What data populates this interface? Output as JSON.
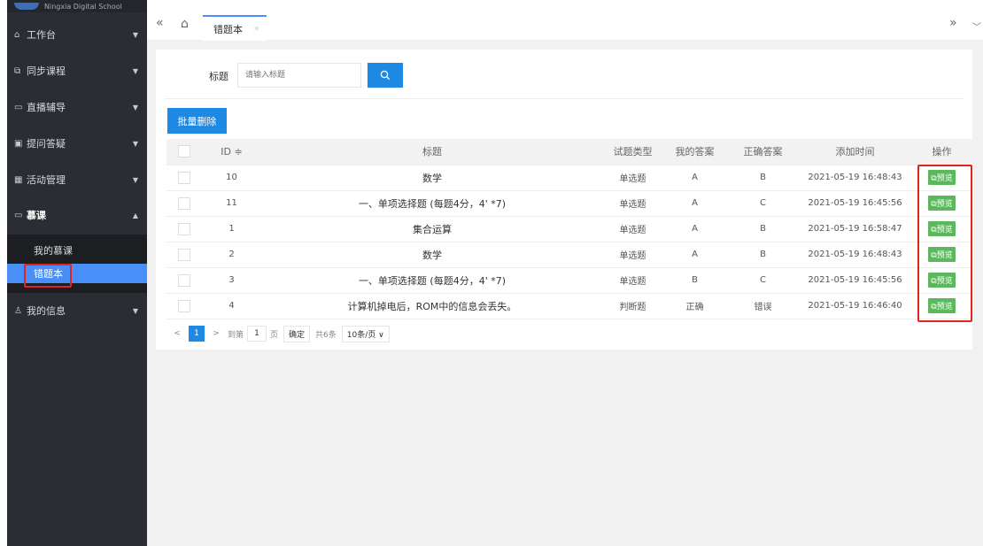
{
  "brand": {
    "name": "Ningxia Digital School"
  },
  "sidebar": {
    "items": [
      {
        "icon": "home-icon",
        "label": "工作台"
      },
      {
        "icon": "book-icon",
        "label": "同步课程"
      },
      {
        "icon": "broadcast-icon",
        "label": "直播辅导"
      },
      {
        "icon": "question-icon",
        "label": "提问答疑"
      },
      {
        "icon": "grid-icon",
        "label": "活动管理"
      },
      {
        "icon": "video-icon",
        "label": "慕课"
      },
      {
        "icon": "user-icon",
        "label": "我的信息"
      }
    ],
    "mooc_sub": [
      {
        "label": "我的慕课"
      },
      {
        "label": "错题本"
      }
    ]
  },
  "tabbar": {
    "collapse_icon": "«",
    "home_icon": "⌂",
    "active_tab": "错题本",
    "close_icon": "×",
    "next_icon": "»",
    "dropdown_icon": "﹀"
  },
  "search": {
    "label": "标题",
    "placeholder": "请输入标题"
  },
  "toolbar": {
    "batch_delete": "批量删除"
  },
  "table": {
    "headers": [
      "ID ≑",
      "标题",
      "试题类型",
      "我的答案",
      "正确答案",
      "添加时间",
      "操作"
    ],
    "rows": [
      {
        "id": "10",
        "title": "数学",
        "type": "单选题",
        "mine": "A",
        "correct": "B",
        "time": "2021-05-19 16:48:43",
        "action": "预览"
      },
      {
        "id": "11",
        "title": "一、单项选择题 (每题4分，4' *7)",
        "type": "单选题",
        "mine": "A",
        "correct": "C",
        "time": "2021-05-19 16:45:56",
        "action": "预览"
      },
      {
        "id": "1",
        "title": "集合运算",
        "type": "单选题",
        "mine": "A",
        "correct": "B",
        "time": "2021-05-19 16:58:47",
        "action": "预览"
      },
      {
        "id": "2",
        "title": "数学",
        "type": "单选题",
        "mine": "A",
        "correct": "B",
        "time": "2021-05-19 16:48:43",
        "action": "预览"
      },
      {
        "id": "3",
        "title": "一、单项选择题 (每题4分，4' *7)",
        "type": "单选题",
        "mine": "B",
        "correct": "C",
        "time": "2021-05-19 16:45:56",
        "action": "预览"
      },
      {
        "id": "4",
        "title": "计算机掉电后，ROM中的信息会丢失。",
        "type": "判断题",
        "mine": "正确",
        "correct": "错误",
        "time": "2021-05-19 16:46:40",
        "action": "预览"
      }
    ]
  },
  "pager": {
    "prev": "<",
    "current": "1",
    "next": ">",
    "goto": "到第",
    "page_value": "1",
    "page_unit": "页",
    "confirm": "确定",
    "total": "共6条",
    "size": "10条/页 ∨"
  }
}
